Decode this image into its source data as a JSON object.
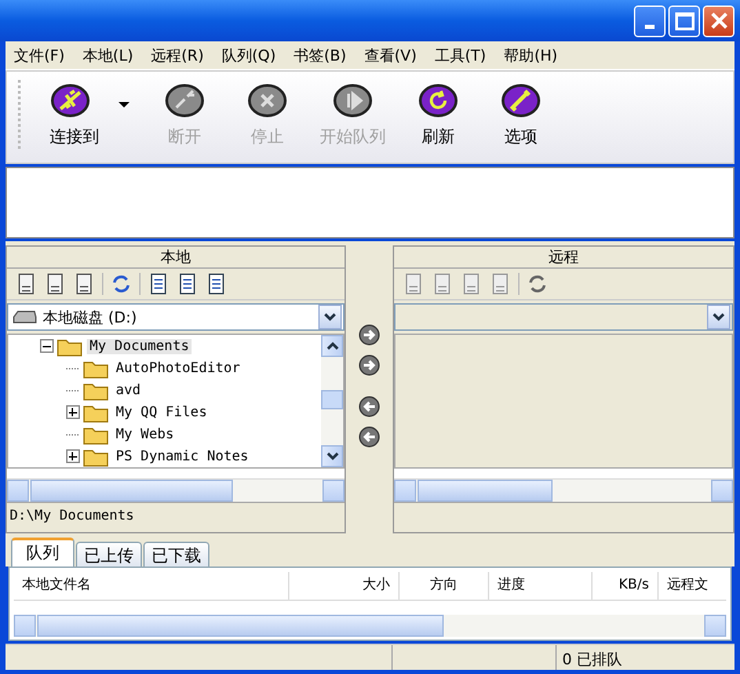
{
  "menu": [
    "文件(F)",
    "本地(L)",
    "远程(R)",
    "队列(Q)",
    "书签(B)",
    "查看(V)",
    "工具(T)",
    "帮助(H)"
  ],
  "toolbar": [
    {
      "label": "连接到",
      "disabled": false,
      "dropdown": true
    },
    {
      "label": "断开",
      "disabled": true,
      "dropdown": false
    },
    {
      "label": "停止",
      "disabled": true,
      "dropdown": false
    },
    {
      "label": "开始队列",
      "disabled": true,
      "dropdown": false
    },
    {
      "label": "刷新",
      "disabled": false,
      "dropdown": false
    },
    {
      "label": "选项",
      "disabled": false,
      "dropdown": false
    }
  ],
  "local": {
    "title": "本地",
    "drive": "本地磁盘 (D:)",
    "path": "D:\\My Documents",
    "tree": [
      {
        "label": "My Documents",
        "kind": "branch",
        "expanded": true,
        "selected": true,
        "children": [
          {
            "label": "AutoPhotoEditor",
            "kind": "leaf",
            "selected": false
          },
          {
            "label": "avd",
            "kind": "leaf",
            "selected": false
          },
          {
            "label": "My QQ Files",
            "kind": "branch",
            "expanded": false,
            "selected": false
          },
          {
            "label": "My Webs",
            "kind": "leaf",
            "selected": false
          },
          {
            "label": "PS Dynamic Notes",
            "kind": "branch",
            "expanded": false,
            "selected": false
          }
        ]
      }
    ]
  },
  "remote": {
    "title": "远程"
  },
  "queue_tabs": [
    {
      "label": "队列",
      "selected": true
    },
    {
      "label": "已上传",
      "selected": false
    },
    {
      "label": "已下载",
      "selected": false
    }
  ],
  "queue_columns": [
    "本地文件名",
    "大小",
    "方向",
    "进度",
    "KB/s",
    "远程文"
  ],
  "status_bar": [
    "0 已排队"
  ]
}
